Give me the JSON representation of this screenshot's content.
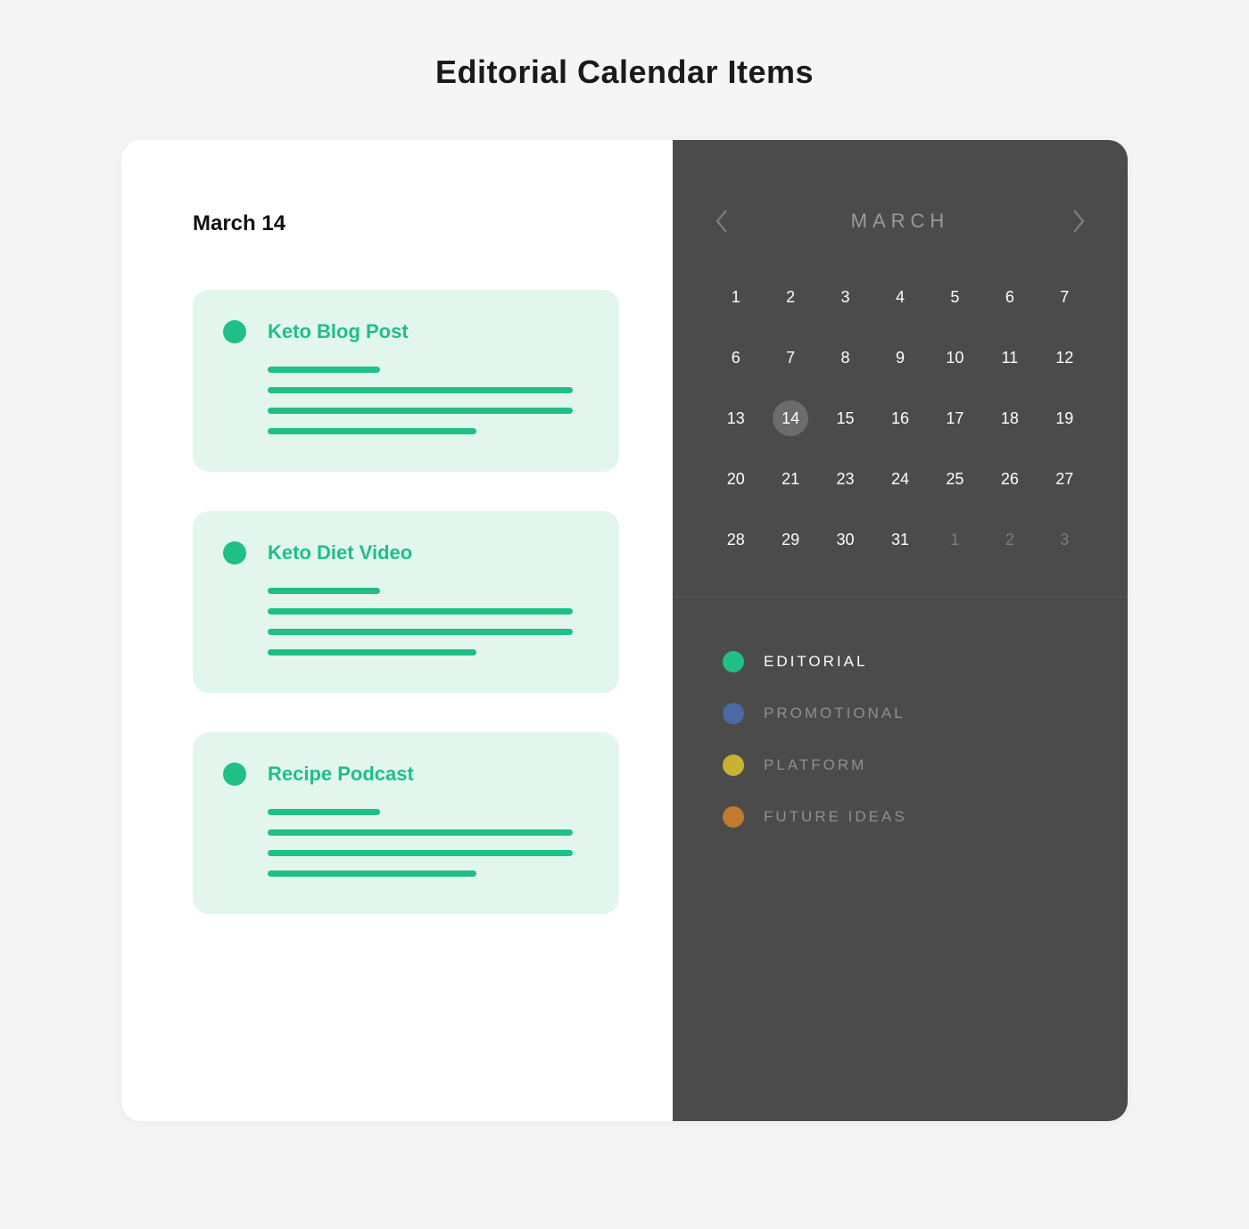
{
  "page_title": "Editorial Calendar Items",
  "selected_date_label": "March 14",
  "items": [
    {
      "title": "Keto Blog Post",
      "category_color": "#1fbf87"
    },
    {
      "title": "Keto Diet Video",
      "category_color": "#1fbf87"
    },
    {
      "title": "Recipe Podcast",
      "category_color": "#1fbf87"
    }
  ],
  "calendar": {
    "month_label": "MARCH",
    "selected_day": 14,
    "days": [
      {
        "n": 1,
        "muted": false
      },
      {
        "n": 2,
        "muted": false
      },
      {
        "n": 3,
        "muted": false
      },
      {
        "n": 4,
        "muted": false
      },
      {
        "n": 5,
        "muted": false
      },
      {
        "n": 6,
        "muted": false
      },
      {
        "n": 7,
        "muted": false
      },
      {
        "n": 6,
        "muted": false
      },
      {
        "n": 7,
        "muted": false
      },
      {
        "n": 8,
        "muted": false
      },
      {
        "n": 9,
        "muted": false
      },
      {
        "n": 10,
        "muted": false
      },
      {
        "n": 11,
        "muted": false
      },
      {
        "n": 12,
        "muted": false
      },
      {
        "n": 13,
        "muted": false
      },
      {
        "n": 14,
        "muted": false
      },
      {
        "n": 15,
        "muted": false
      },
      {
        "n": 16,
        "muted": false
      },
      {
        "n": 17,
        "muted": false
      },
      {
        "n": 18,
        "muted": false
      },
      {
        "n": 19,
        "muted": false
      },
      {
        "n": 20,
        "muted": false
      },
      {
        "n": 21,
        "muted": false
      },
      {
        "n": 23,
        "muted": false
      },
      {
        "n": 24,
        "muted": false
      },
      {
        "n": 25,
        "muted": false
      },
      {
        "n": 26,
        "muted": false
      },
      {
        "n": 27,
        "muted": false
      },
      {
        "n": 28,
        "muted": false
      },
      {
        "n": 29,
        "muted": false
      },
      {
        "n": 30,
        "muted": false
      },
      {
        "n": 31,
        "muted": false
      },
      {
        "n": 1,
        "muted": true
      },
      {
        "n": 2,
        "muted": true
      },
      {
        "n": 3,
        "muted": true
      }
    ]
  },
  "legend": [
    {
      "label": "EDITORIAL",
      "color": "#1fbf87",
      "active": true
    },
    {
      "label": "PROMOTIONAL",
      "color": "#4a69a5",
      "active": false
    },
    {
      "label": "PLATFORM",
      "color": "#c9b233",
      "active": false
    },
    {
      "label": "FUTURE IDEAS",
      "color": "#c17a2f",
      "active": false
    }
  ]
}
